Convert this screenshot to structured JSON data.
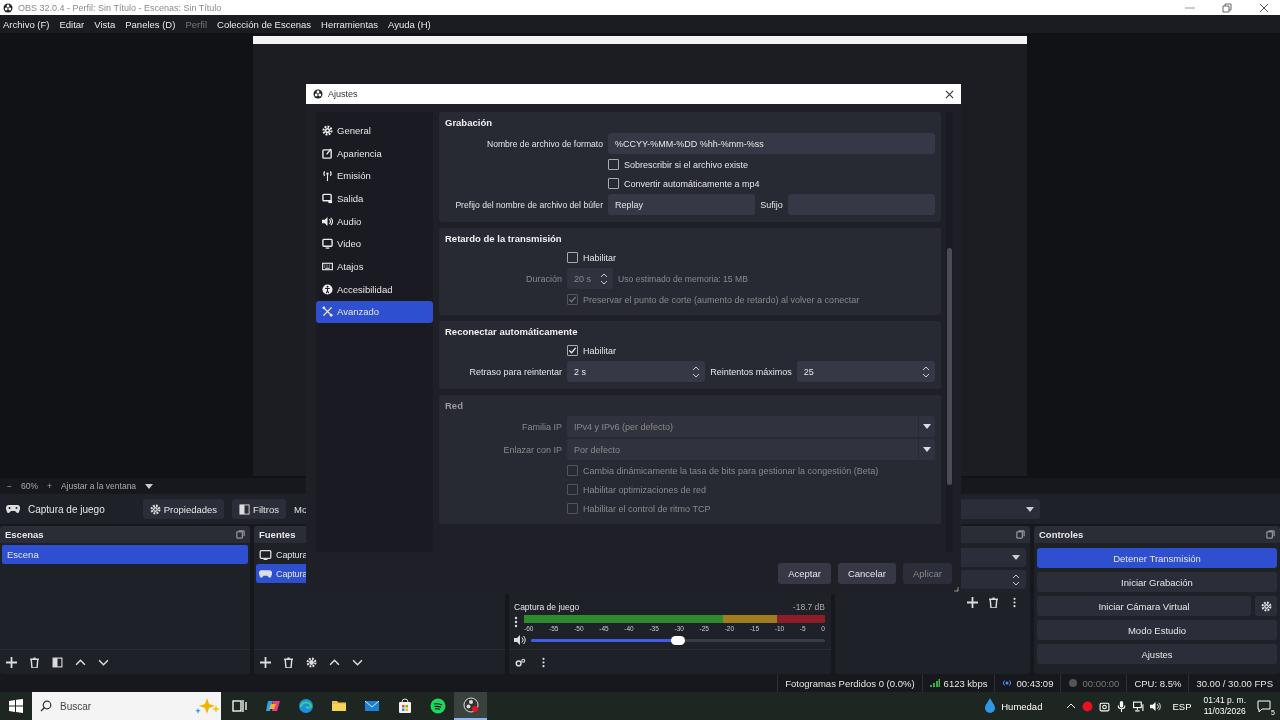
{
  "window": {
    "title": "OBS 32.0.4 - Perfil: Sin Título - Escenas: Sin Título"
  },
  "menu": [
    {
      "label": "Archivo (F)",
      "disabled": false
    },
    {
      "label": "Editar",
      "disabled": false
    },
    {
      "label": "Vista",
      "disabled": false
    },
    {
      "label": "Paneles (D)",
      "disabled": false
    },
    {
      "label": "Perfil",
      "disabled": true
    },
    {
      "label": "Colección de Escenas",
      "disabled": false
    },
    {
      "label": "Herramientas",
      "disabled": false
    },
    {
      "label": "Ayuda (H)",
      "disabled": false
    }
  ],
  "zoom_bar": {
    "zoom_out": "−",
    "zoom": "60%",
    "zoom_in": "+",
    "fit": "Ajustar a la ventana"
  },
  "source_toolbar": {
    "source": "Captura de juego",
    "buttons": [
      "Propiedades",
      "Filtros"
    ],
    "cut_label": "Mo"
  },
  "scenes": {
    "title": "Escenas",
    "items": [
      {
        "label": "Escena",
        "selected": true
      }
    ]
  },
  "sources": {
    "title": "Fuentes",
    "items": [
      {
        "label": "Captura",
        "selected": false
      },
      {
        "label": "Captura",
        "selected": true
      }
    ]
  },
  "mixer": {
    "channels": [
      {
        "name": "Captura de juego",
        "reading": "-18.7 dB",
        "level": 0.5
      }
    ],
    "scale": [
      "-60",
      "-55",
      "-50",
      "-45",
      "-40",
      "-35",
      "-30",
      "-25",
      "-20",
      "-15",
      "-10",
      "-5",
      "0"
    ]
  },
  "controls": {
    "title": "Controles",
    "buttons": [
      {
        "label": "Detener Transmisión",
        "active": true,
        "settings": false
      },
      {
        "label": "Iniciar Grabación",
        "active": false,
        "settings": false
      },
      {
        "label": "Iniciar Cámara Virtual",
        "active": false,
        "settings": true
      },
      {
        "label": "Modo Estudio",
        "active": false,
        "settings": false
      },
      {
        "label": "Ajustes",
        "active": false,
        "settings": false
      }
    ]
  },
  "status_bar": {
    "dropped": "Fotogramas Perdidos 0 (0.0%)",
    "bitrate": "6123 kbps",
    "stream_time": "00:43:09",
    "record_time": "00:00:00",
    "cpu": "CPU: 8.5%",
    "fps": "30.00 / 30.00 FPS"
  },
  "dialog": {
    "title": "Ajustes",
    "nav": [
      {
        "label": "General",
        "selected": false
      },
      {
        "label": "Apariencia",
        "selected": false
      },
      {
        "label": "Emisión",
        "selected": false
      },
      {
        "label": "Salida",
        "selected": false
      },
      {
        "label": "Audio",
        "selected": false
      },
      {
        "label": "Video",
        "selected": false
      },
      {
        "label": "Atajos",
        "selected": false
      },
      {
        "label": "Accesibilidad",
        "selected": false
      },
      {
        "label": "Avanzado",
        "selected": true
      }
    ],
    "sections": [
      {
        "title": "Grabación",
        "disabled": false,
        "rows": [
          {
            "kind": "fields",
            "disabled": false,
            "fields": [
              {
                "kind": "text",
                "label": "Nombre de archivo de formato",
                "value": "%CCYY-%MM-%DD %hh-%mm-%ss"
              }
            ]
          },
          {
            "kind": "checkbox",
            "label": "Sobrescribir si el archivo existe",
            "checked": false,
            "disabled": false
          },
          {
            "kind": "checkbox",
            "label": "Convertir automáticamente a mp4",
            "checked": false,
            "disabled": false
          },
          {
            "kind": "fields",
            "disabled": false,
            "fields": [
              {
                "kind": "text",
                "label": "Prefijo del nombre de archivo del búfer",
                "value": "Replay"
              },
              {
                "kind": "text",
                "label": "Sufijo"
              }
            ]
          }
        ]
      },
      {
        "title": "Retardo de la transmisión",
        "disabled": false,
        "rows": [
          {
            "kind": "checkbox",
            "label": "Habilitar",
            "checked": false,
            "disabled": false
          },
          {
            "kind": "fields",
            "disabled": true,
            "note": "Uso estimado de memoria: 15 MB",
            "fields": [
              {
                "kind": "spin",
                "label": "Duración",
                "value": "20 s"
              }
            ]
          },
          {
            "kind": "checkbox",
            "label": "Preservar el punto de corte (aumento de retardo) al volver a conectar",
            "checked": true,
            "disabled": true
          }
        ]
      },
      {
        "title": "Reconectar automáticamente",
        "disabled": false,
        "rows": [
          {
            "kind": "checkbox",
            "label": "Habilitar",
            "checked": true,
            "disabled": false
          },
          {
            "kind": "fields",
            "disabled": false,
            "fields": [
              {
                "kind": "spin",
                "label": "Retraso para reintentar",
                "value": "2 s"
              },
              {
                "kind": "spin",
                "label": "Reintentos máximos",
                "value": "25"
              }
            ]
          }
        ]
      },
      {
        "title": "Red",
        "disabled": true,
        "rows": [
          {
            "kind": "fields",
            "disabled": true,
            "fields": [
              {
                "kind": "select",
                "label": "Familia IP",
                "value": "IPv4 y IPv6 (per defecto)"
              }
            ]
          },
          {
            "kind": "fields",
            "disabled": true,
            "fields": [
              {
                "kind": "select",
                "label": "Enlazar con IP",
                "value": "Por defecto"
              }
            ]
          },
          {
            "kind": "checkbox",
            "label": "Cambia dinámicamente la tasa de bits para gestionar la congestión (Beta)",
            "checked": false,
            "disabled": true
          },
          {
            "kind": "checkbox",
            "label": "Habilitar optimizaciones de red",
            "checked": false,
            "disabled": true
          },
          {
            "kind": "checkbox",
            "label": "Habilitar el control de ritmo TCP",
            "checked": false,
            "disabled": true
          }
        ]
      }
    ],
    "buttons": [
      {
        "label": "Aceptar",
        "disabled": false
      },
      {
        "label": "Cancelar",
        "disabled": false
      },
      {
        "label": "Aplicar",
        "disabled": true
      }
    ]
  },
  "taskbar": {
    "search": {
      "placeholder": "Buscar"
    },
    "apps": [
      {
        "selected": false
      },
      {
        "selected": false
      },
      {
        "selected": false
      },
      {
        "selected": false
      },
      {
        "selected": false
      },
      {
        "selected": false
      },
      {
        "selected": false
      },
      {
        "selected": true
      }
    ],
    "weather": "Humedad",
    "language": "ESP",
    "time": "01:41 p. m.",
    "date": "11/03/2026",
    "notifications": "5"
  }
}
